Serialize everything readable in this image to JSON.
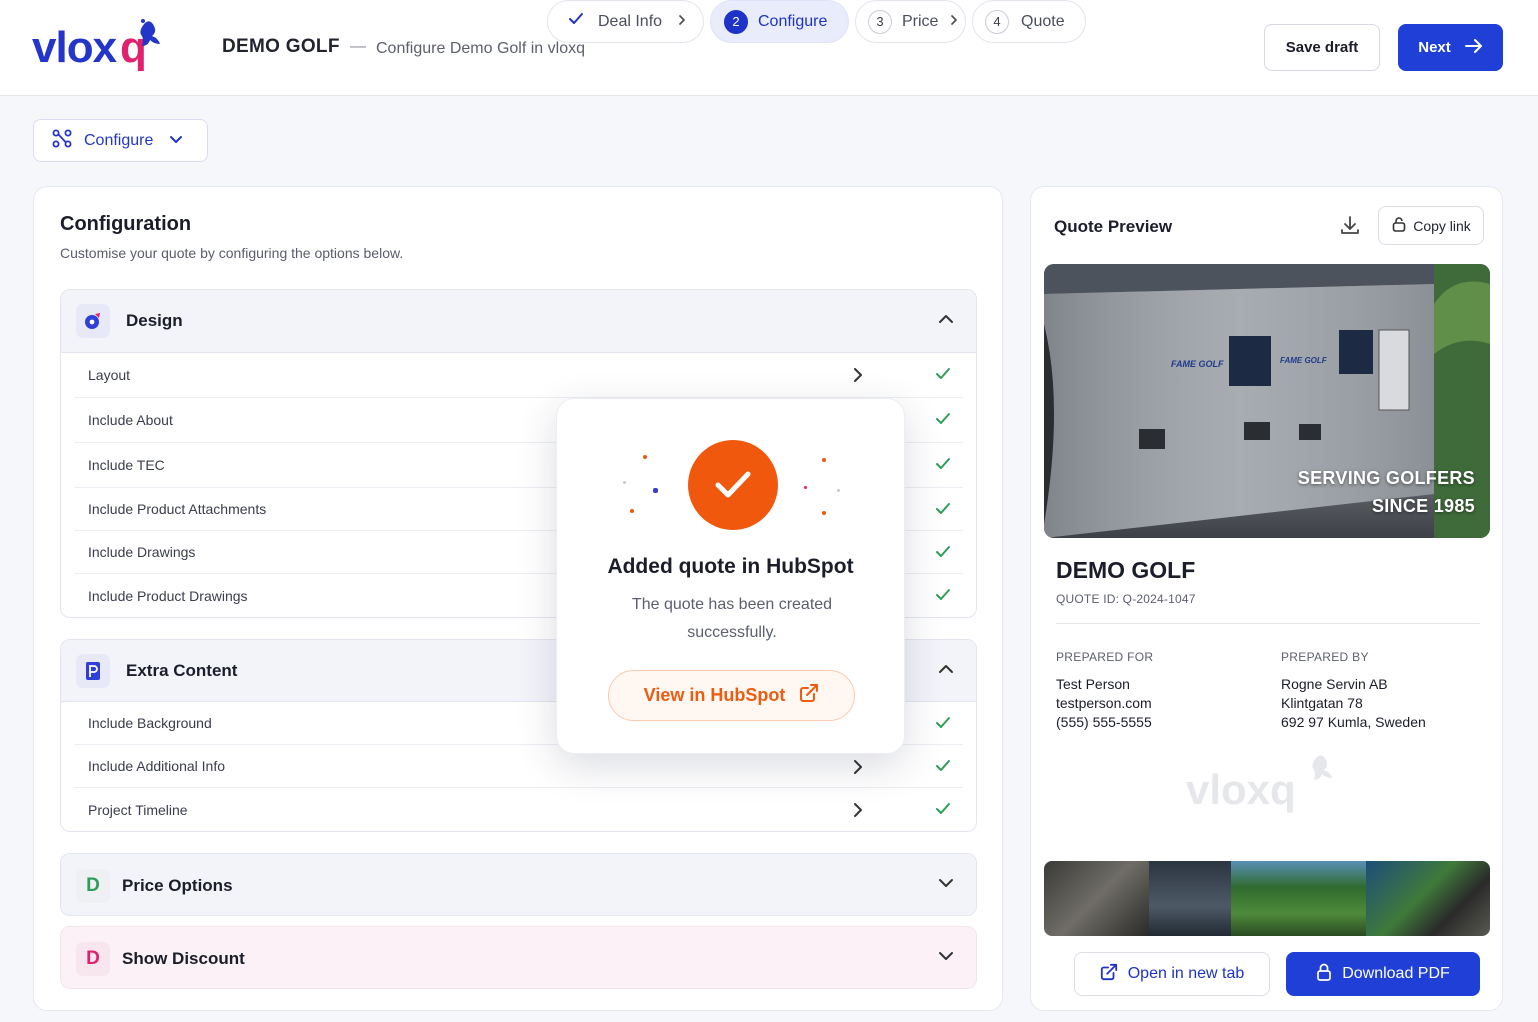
{
  "header": {
    "logo_text": "vloxq",
    "app_title": "DEMO GOLF",
    "separator": "—",
    "subtitle": "Configure Demo Golf in vloxq",
    "save_label": "Save draft",
    "next_label": "Next"
  },
  "toolbar": {
    "dropdown_label": "Configure"
  },
  "steps": [
    {
      "num": "",
      "label": "Deal Info",
      "state": "done"
    },
    {
      "num": "2",
      "label": "Configure",
      "state": "active"
    },
    {
      "num": "3",
      "label": "Price",
      "state": "pending"
    },
    {
      "num": "4",
      "label": "Quote",
      "state": "pending"
    }
  ],
  "config": {
    "title": "Configuration",
    "subtitle": "Customise your quote by configuring the options below.",
    "sections": [
      {
        "label": "Design",
        "icon": "palette-icon",
        "expanded": true,
        "rows": [
          {
            "label": "Layout",
            "has_arrow": true,
            "checked": true
          },
          {
            "label": "Include About",
            "has_arrow": false,
            "checked": true
          },
          {
            "label": "Include TEC",
            "has_arrow": false,
            "checked": true
          },
          {
            "label": "Include Product Attachments",
            "has_arrow": false,
            "checked": true
          },
          {
            "label": "Include Drawings",
            "has_arrow": false,
            "checked": true
          },
          {
            "label": "Include Product Drawings",
            "has_arrow": false,
            "checked": true
          }
        ]
      },
      {
        "label": "Extra Content",
        "icon": "document-icon",
        "expanded": true,
        "rows": [
          {
            "label": "Include Background",
            "has_arrow": false,
            "checked": true
          },
          {
            "label": "Include Additional Info",
            "has_arrow": true,
            "checked": true
          },
          {
            "label": "Project Timeline",
            "has_arrow": true,
            "checked": true
          }
        ]
      },
      {
        "label": "Price Options",
        "icon_letter": "D",
        "icon_color": "#2e9e57",
        "expanded": false,
        "rows": []
      },
      {
        "label": "Show Discount",
        "icon_letter": "D",
        "icon_color": "#e0226e",
        "expanded": false,
        "rows": []
      }
    ]
  },
  "modal": {
    "title": "Added quote in HubSpot",
    "message": "The quote has been created successfully.",
    "button_label": "View in HubSpot"
  },
  "preview": {
    "title": "Quote Preview",
    "copy_label": "Copy link",
    "hero_line1": "SERVING GOLFERS",
    "hero_line2": "SINCE 1985",
    "hero_brand": "FAME GOLF",
    "company": "DEMO GOLF",
    "quote_id": "QUOTE ID: Q-2024-1047",
    "prepared_for_label": "PREPARED FOR",
    "prepared_for": [
      "Test Person",
      "testperson.com",
      "(555) 555-5555"
    ],
    "prepared_by_label": "PREPARED BY",
    "prepared_by": [
      "Rogne Servin AB",
      "Klintgatan 78",
      "692 97 Kumla, Sweden"
    ],
    "watermark": "vloxq",
    "open_label": "Open in new tab",
    "pdf_label": "Download PDF"
  },
  "colors": {
    "primary": "#1f3fd6",
    "success": "#2e9e57",
    "accent": "#f0580d"
  }
}
